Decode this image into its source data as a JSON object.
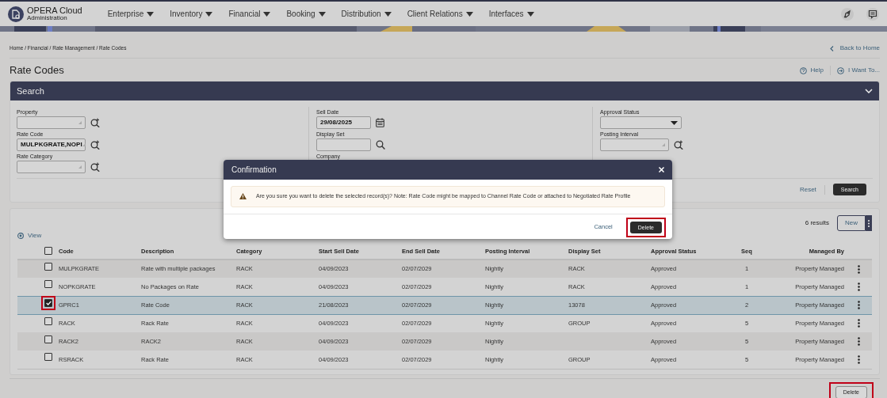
{
  "app": {
    "name": "OPERA Cloud",
    "subtitle": "Administration"
  },
  "menu": [
    {
      "label": "Enterprise"
    },
    {
      "label": "Inventory"
    },
    {
      "label": "Financial"
    },
    {
      "label": "Booking"
    },
    {
      "label": "Distribution"
    },
    {
      "label": "Client Relations"
    },
    {
      "label": "Interfaces"
    }
  ],
  "breadcrumb": "Home / Financial / Rate Management / Rate Codes",
  "back_link": "Back to Home",
  "page_title": "Rate Codes",
  "help": "Help",
  "i_want_to": "I Want To...",
  "search_panel": {
    "title": "Search",
    "columns": [
      [
        {
          "label": "Property",
          "kind": "lookup"
        },
        {
          "label": "Rate Code",
          "kind": "lookup",
          "value": "MULPKGRATE,NOPI"
        },
        {
          "label": "Rate Category",
          "kind": "lookup"
        }
      ],
      [
        {
          "label": "Sell Date",
          "kind": "date",
          "value": "29/08/2025"
        },
        {
          "label": "Display Set",
          "kind": "search"
        },
        {
          "label": "Company",
          "kind": "covered"
        }
      ],
      [
        {
          "label": "Approval Status",
          "kind": "select"
        },
        {
          "label": "Posting Interval",
          "kind": "lookup"
        }
      ]
    ],
    "reset": "Reset",
    "search": "Search"
  },
  "results": {
    "count": "6 results",
    "new": "New",
    "view": "View",
    "select_all": {
      "checked": false
    },
    "columns": [
      "Code",
      "Description",
      "Category",
      "Start Sell Date",
      "End Sell Date",
      "Posting Interval",
      "Display Set",
      "Approval Status",
      "Seq",
      "Managed By"
    ],
    "rows": [
      {
        "cells": [
          "MULPKGRATE",
          "Rate with multiple packages",
          "RACK",
          "04/09/2023",
          "02/07/2029",
          "Nightly",
          "RACK",
          "Approved",
          "1",
          "Property Managed"
        ],
        "selected": false,
        "highlighted": false
      },
      {
        "cells": [
          "NOPKGRATE",
          "No Packages on Rate",
          "RACK",
          "04/09/2023",
          "02/07/2029",
          "Nightly",
          "RACK",
          "Approved",
          "1",
          "Property Managed"
        ],
        "selected": false,
        "highlighted": false
      },
      {
        "cells": [
          "GPRC1",
          "Rate Code",
          "RACK",
          "21/08/2023",
          "02/07/2029",
          "Nightly",
          "13078",
          "Approved",
          "2",
          "Property Managed"
        ],
        "selected": true,
        "highlighted": true
      },
      {
        "cells": [
          "RACK",
          "Rack Rate",
          "RACK",
          "04/09/2023",
          "02/07/2029",
          "Nightly",
          "GROUP",
          "Approved",
          "5",
          "Property Managed"
        ],
        "selected": false,
        "highlighted": false
      },
      {
        "cells": [
          "RACK2",
          "RACK2",
          "RACK",
          "04/09/2023",
          "02/07/2029",
          "Nightly",
          null,
          "Approved",
          "5",
          "Property Managed"
        ],
        "selected": false,
        "highlighted": false
      },
      {
        "cells": [
          "RSRACK",
          "Rack Rate",
          "RACK",
          "04/09/2023",
          "02/07/2029",
          "Nightly",
          "GROUP",
          "Approved",
          "5",
          "Property Managed"
        ],
        "selected": false,
        "highlighted": false
      }
    ]
  },
  "footer_delete": {
    "label": "Delete",
    "highlighted": true
  },
  "dialog": {
    "title": "Confirmation",
    "message": "Are you sure you want to delete the selected record(s)? Note: Rate Code might be mapped to Channel Rate Code or attached to Negotiated Rate Profile",
    "cancel": "Cancel",
    "delete": {
      "label": "Delete",
      "highlighted": true
    }
  }
}
